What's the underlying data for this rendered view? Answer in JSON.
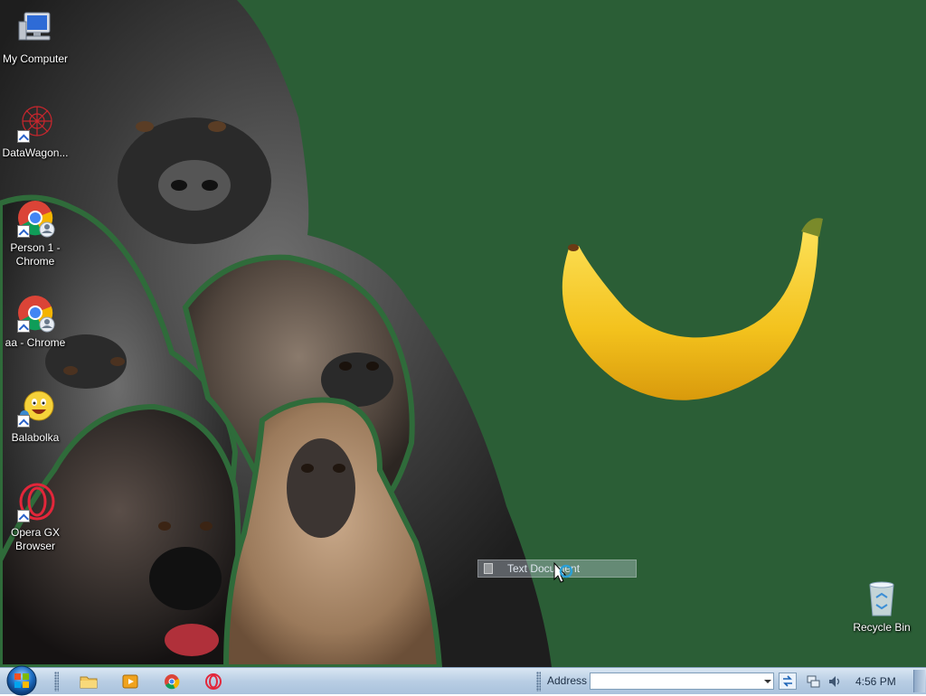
{
  "desktop": {
    "background_color": "#2b5e36",
    "icons": [
      {
        "label": "My Computer",
        "icon": "computer-icon"
      },
      {
        "label": "DataWagon...",
        "icon": "datawagon-icon"
      },
      {
        "label": "Person 1 - Chrome",
        "icon": "chrome-icon"
      },
      {
        "label": "aa - Chrome",
        "icon": "chrome-icon"
      },
      {
        "label": "Balabolka",
        "icon": "balabolka-icon"
      },
      {
        "label": "Opera GX Browser",
        "icon": "opera-gx-icon"
      },
      {
        "label": "Recycle Bin",
        "icon": "recycle-bin-icon"
      }
    ],
    "drag_ghost_label": "Text Document"
  },
  "taskbar": {
    "pinned": [
      {
        "name": "file-explorer-icon"
      },
      {
        "name": "media-player-icon"
      },
      {
        "name": "chrome-icon"
      },
      {
        "name": "opera-gx-icon"
      }
    ],
    "address_label": "Address",
    "address_value": "",
    "clock": "4:56 PM"
  }
}
